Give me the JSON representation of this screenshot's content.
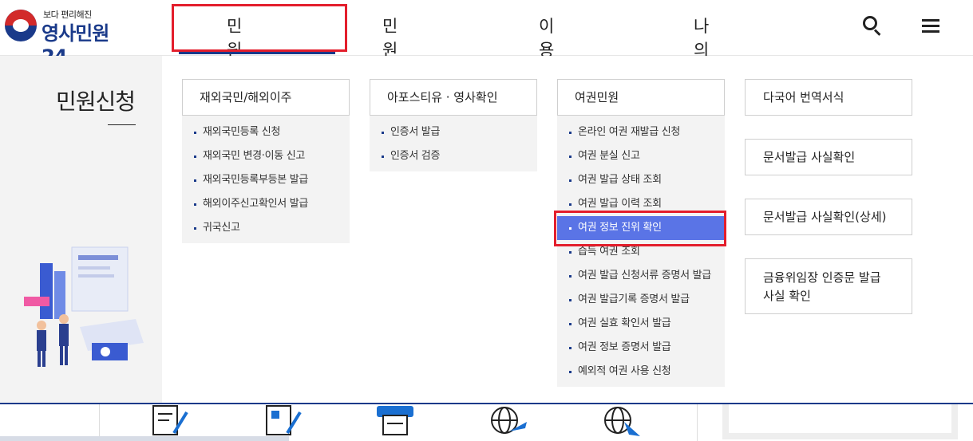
{
  "brand": {
    "slogan": "보다 편리해진",
    "name": "영사민원24"
  },
  "gnb": [
    {
      "label": "민원신청"
    },
    {
      "label": "민원안내"
    },
    {
      "label": "이용안내"
    },
    {
      "label": "나의 민원"
    }
  ],
  "header_icons": {
    "search": "search-icon",
    "menu": "hamburger-menu-icon"
  },
  "mega": {
    "title": "민원신청",
    "columns": [
      {
        "head": "재외국민/해외이주",
        "items": [
          "재외국민등록 신청",
          "재외국민 변경·이동 신고",
          "재외국민등록부등본 발급",
          "해외이주신고확인서 발급",
          "귀국신고"
        ]
      },
      {
        "head": "아포스티유 · 영사확인",
        "items": [
          "인증서 발급",
          "인증서 검증"
        ]
      },
      {
        "head": "여권민원",
        "items": [
          "온라인 여권 재발급 신청",
          "여권 분실 신고",
          "여권 발급 상태 조회",
          "여권 발급 이력 조회",
          "여권 정보 진위 확인",
          "습득 여권 조회",
          "여권 발급 신청서류 증명서 발급",
          "여권 발급기록 증명서 발급",
          "여권 실효 확인서 발급",
          "여권 정보 증명서 발급",
          "예외적 여권 사용 신청"
        ],
        "highlighted_index": 4
      }
    ],
    "side_buttons": [
      "다국어 번역서식",
      "문서발급 사실확인",
      "문서발급 사실확인(상세)",
      "금융위임장 인증문 발급",
      "사실 확인"
    ]
  },
  "colors": {
    "accent": "#1a3a8a",
    "highlight": "#5a74e6",
    "annotation": "#e31e2c"
  }
}
